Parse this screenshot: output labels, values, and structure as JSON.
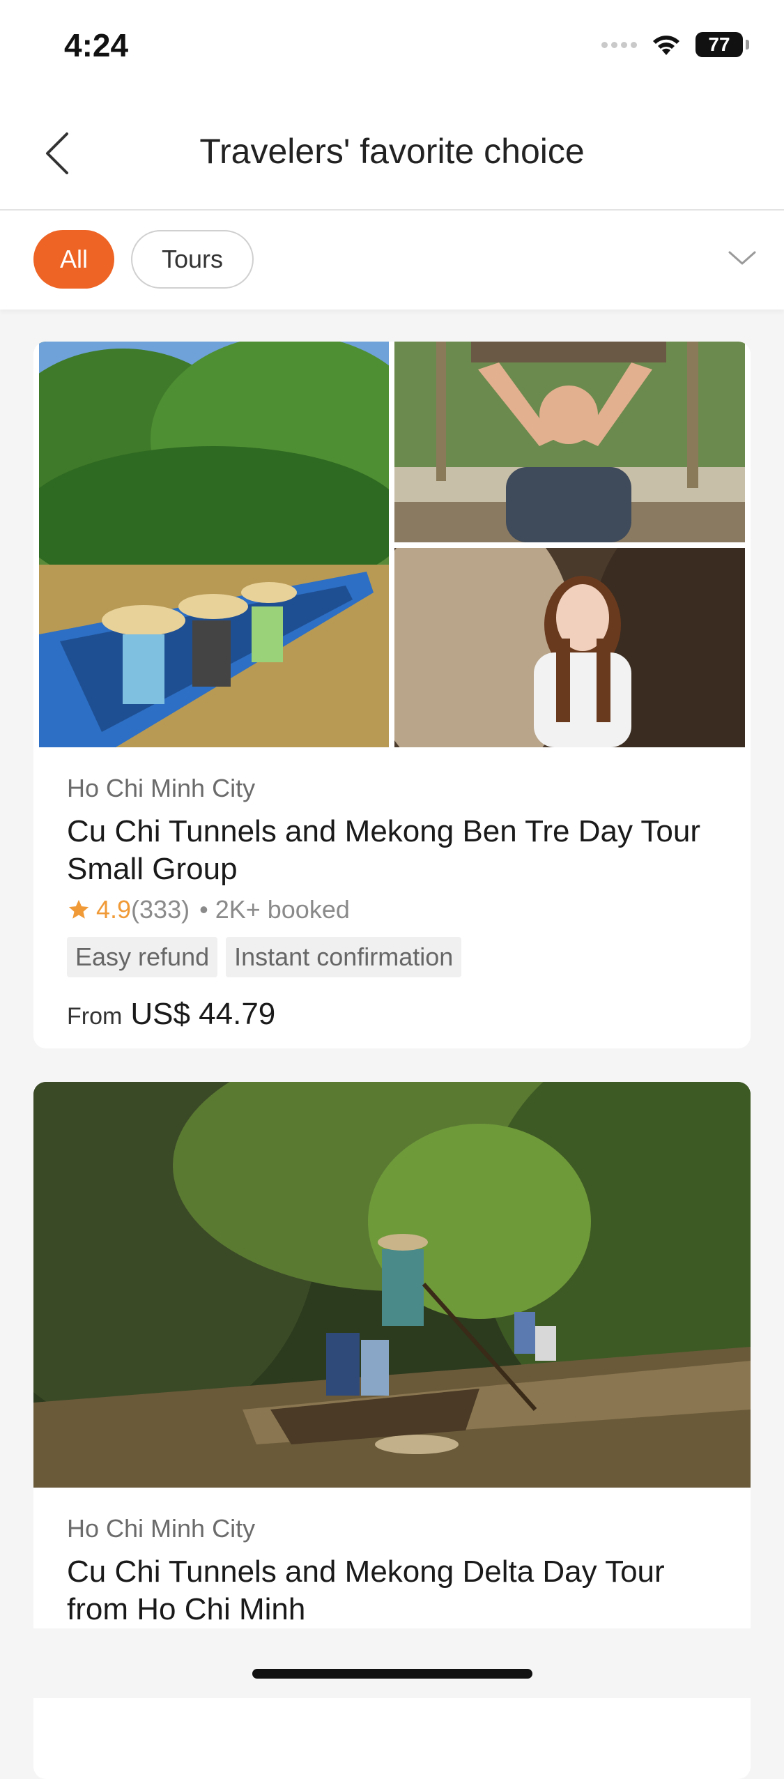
{
  "status_bar": {
    "time": "4:24",
    "battery": "77"
  },
  "header": {
    "title": "Travelers' favorite choice",
    "back_icon": "chevron-left-icon"
  },
  "filters": {
    "chips": [
      "All",
      "Tours"
    ],
    "active": "All",
    "expand_icon": "chevron-down-icon"
  },
  "colors": {
    "accent": "#ee6425",
    "rating": "#f09a37"
  },
  "cards": [
    {
      "city": "Ho Chi Minh City",
      "title": "Cu Chi Tunnels and Mekong Ben Tre Day Tour Small Group",
      "rating": "4.9",
      "rating_count": "(333)",
      "booked": "• 2K+ booked",
      "tags": [
        "Easy refund",
        "Instant confirmation"
      ],
      "price_prefix": "From",
      "price": "US$ 44.79"
    },
    {
      "city": "Ho Chi Minh City",
      "title": "Cu Chi Tunnels and Mekong Delta Day Tour from Ho Chi Minh"
    }
  ]
}
